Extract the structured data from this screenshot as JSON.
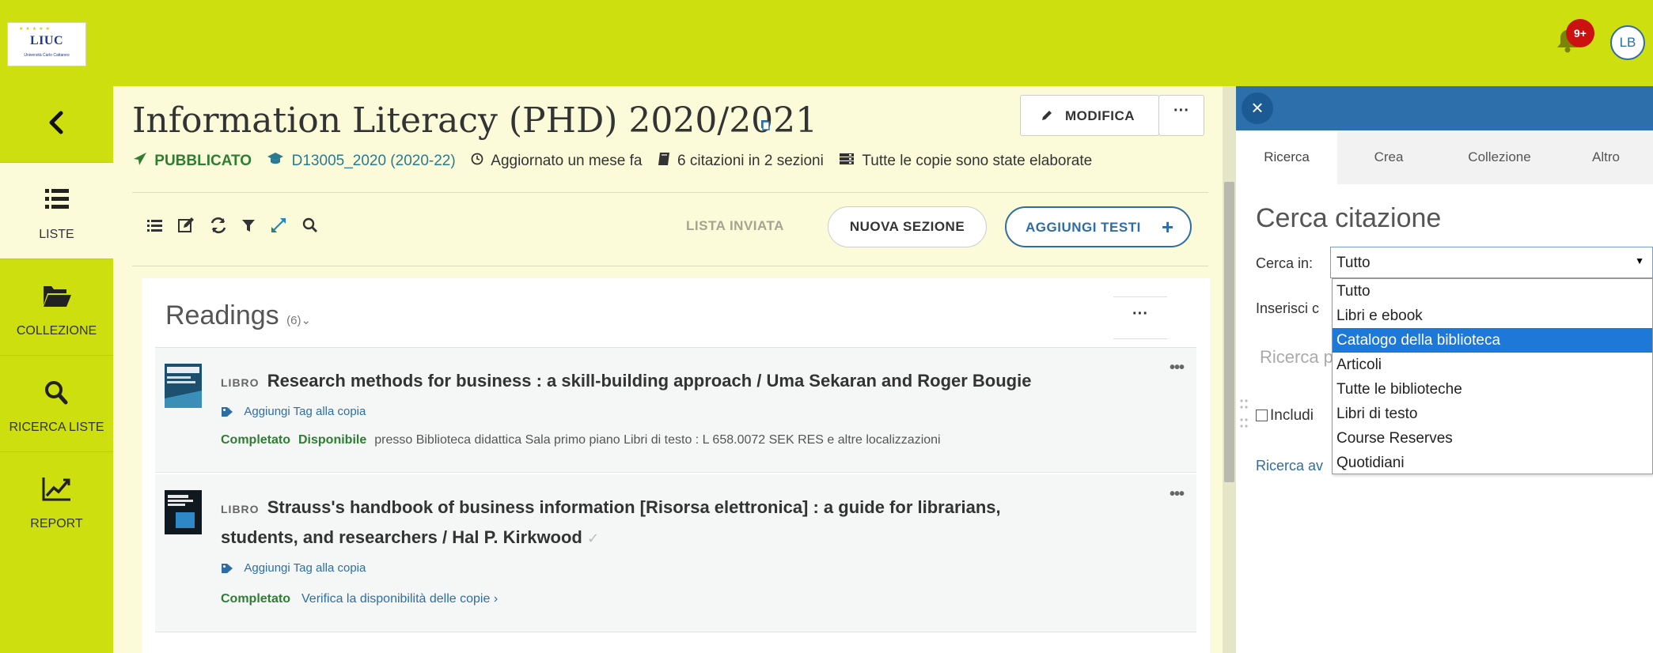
{
  "brand": {
    "logo_text": "LIUC",
    "logo_subtext": "Università Carlo Cattaneo"
  },
  "header": {
    "notification_count": "9+",
    "user_initials": "LB"
  },
  "leftnav": {
    "items": [
      {
        "label": "LISTE",
        "icon": "list-icon",
        "active": true
      },
      {
        "label": "COLLEZIONE",
        "icon": "folder-open-icon",
        "active": false
      },
      {
        "label": "RICERCA LISTE",
        "icon": "search-icon",
        "active": false
      },
      {
        "label": "REPORT",
        "icon": "line-chart-icon",
        "active": false
      }
    ]
  },
  "list": {
    "title": "Information Literacy (PHD) 2020/2021",
    "edit_label": "MODIFICA",
    "more_label": "···",
    "status": "PUBBLICATO",
    "course_code": "D13005_2020 (2020-22)",
    "updated": "Aggiornato un mese fa",
    "citations_summary": "6 citazioni in 2 sezioni",
    "copies_summary": "Tutte le copie sono state elaborate",
    "toolbar": {
      "list_sent_label": "LISTA INVIATA",
      "new_section_label": "NUOVA SEZIONE",
      "add_texts_label": "AGGIUNGI TESTI",
      "add_texts_icon": "+"
    }
  },
  "section": {
    "title": "Readings",
    "count": "(6)",
    "chevron": "⌄",
    "more_label": "···",
    "citations": [
      {
        "type": "LIBRO",
        "title": "Research methods for business : a skill-building approach / Uma Sekaran and Roger Bougie",
        "tag_link": "Aggiungi Tag alla copia",
        "status": "Completato",
        "availability": "Disponibile",
        "location": "presso Biblioteca didattica Sala primo piano Libri di testo : L 658.0072 SEK RES e altre localizzazioni",
        "more_label": "•••"
      },
      {
        "type": "LIBRO",
        "title": "Strauss's handbook of business information [Risorsa elettronica] : a guide for librarians, students, and researchers / Hal P. Kirkwood",
        "tag_link": "Aggiungi Tag alla copia",
        "status": "Completato",
        "check_link": "Verifica la disponibilità delle copie ›",
        "more_label": "•••"
      }
    ]
  },
  "search_panel": {
    "close_icon": "×",
    "tabs": [
      "Ricerca",
      "Crea",
      "Collezione",
      "Altro"
    ],
    "active_tab": "Ricerca",
    "title": "Cerca citazione",
    "search_in_label": "Cerca in:",
    "selected_value": "Tutto",
    "insert_label": "Inserisci c",
    "search_placeholder": "Ricerca p",
    "include_label": "Includi",
    "advanced_link": "Ricerca av",
    "options": [
      "Tutto",
      "Libri e ebook",
      "Catalogo della biblioteca",
      "Articoli",
      "Tutte le biblioteche",
      "Libri di testo",
      "Course Reserves",
      "Quotidiani"
    ],
    "highlighted_option": "Catalogo della biblioteca"
  },
  "colors": {
    "brand_green": "#cddf0e",
    "panel_bg": "#fbfbd9",
    "primary_blue": "#2e6da4",
    "status_green": "#2e7d32",
    "header_blue": "#2d6faa",
    "highlight_blue": "#1e78d8"
  }
}
